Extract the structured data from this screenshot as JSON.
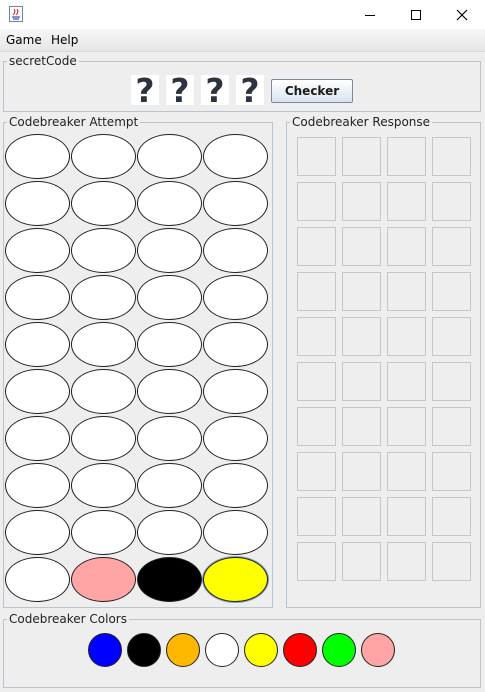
{
  "window": {
    "minimize_glyph": "–",
    "maximize_glyph": "☐",
    "close_glyph": "✕"
  },
  "menu": {
    "items": [
      "Game",
      "Help"
    ]
  },
  "secret_code": {
    "title": "secretCode",
    "slots": [
      "?",
      "?",
      "?",
      "?"
    ],
    "checker_label": "Checker"
  },
  "attempt": {
    "title": "Codebreaker Attempt",
    "rows": [
      [
        "#ffffff",
        "#ffffff",
        "#ffffff",
        "#ffffff"
      ],
      [
        "#ffffff",
        "#ffffff",
        "#ffffff",
        "#ffffff"
      ],
      [
        "#ffffff",
        "#ffffff",
        "#ffffff",
        "#ffffff"
      ],
      [
        "#ffffff",
        "#ffffff",
        "#ffffff",
        "#ffffff"
      ],
      [
        "#ffffff",
        "#ffffff",
        "#ffffff",
        "#ffffff"
      ],
      [
        "#ffffff",
        "#ffffff",
        "#ffffff",
        "#ffffff"
      ],
      [
        "#ffffff",
        "#ffffff",
        "#ffffff",
        "#ffffff"
      ],
      [
        "#ffffff",
        "#ffffff",
        "#ffffff",
        "#ffffff"
      ],
      [
        "#ffffff",
        "#ffffff",
        "#ffffff",
        "#ffffff"
      ],
      [
        "#ffffff",
        "#ffa5a5",
        "#000000",
        "#ffff00"
      ]
    ],
    "selected": {
      "row": 9,
      "col": 3
    }
  },
  "response": {
    "title": "Codebreaker Response",
    "rows": 10,
    "cols": 4
  },
  "colors": {
    "title": "Codebreaker Colors",
    "palette": [
      "#0000ff",
      "#000000",
      "#ffb800",
      "#ffffff",
      "#ffff00",
      "#ff0000",
      "#00ff00",
      "#ffa5a5"
    ]
  }
}
